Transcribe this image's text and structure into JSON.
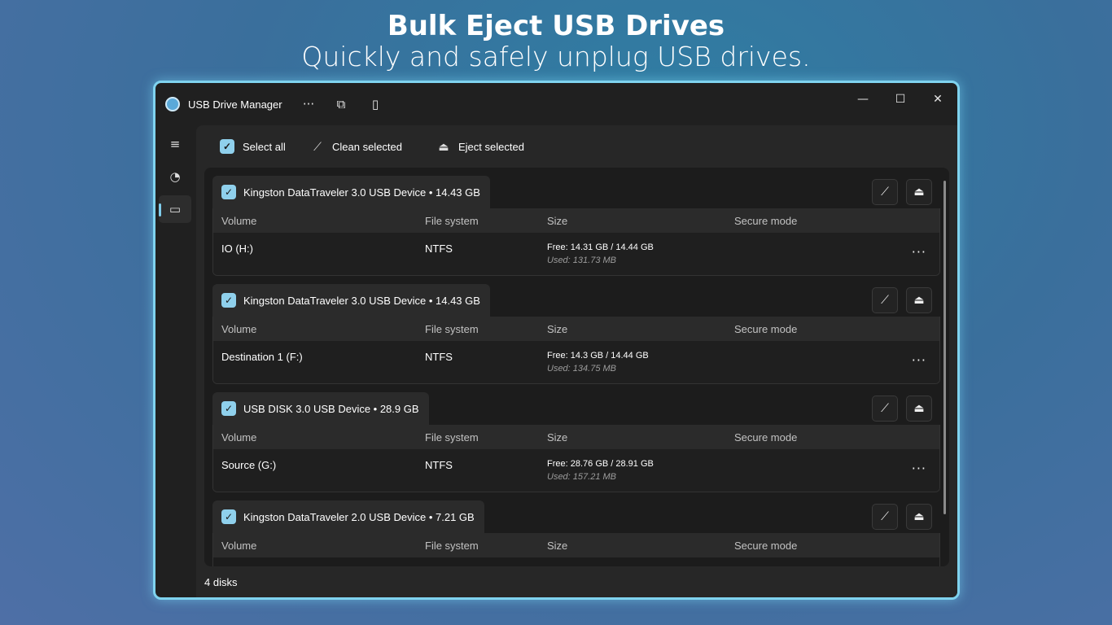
{
  "hero": {
    "title": "Bulk Eject USB Drives",
    "subtitle": "Quickly and safely unplug USB drives."
  },
  "app": {
    "title": "USB Drive Manager",
    "icon": "usb-drive-icon",
    "titlebar_buttons": [
      "more-icon",
      "connect-icon",
      "usb-plug-icon"
    ],
    "window_controls": {
      "minimize": "—",
      "maximize": "☐",
      "close": "✕"
    }
  },
  "sidebar": {
    "items": [
      {
        "name": "hamburger-icon",
        "glyph": "≡"
      },
      {
        "name": "pie-chart-icon",
        "glyph": "◔"
      },
      {
        "name": "drive-icon",
        "glyph": "▭",
        "active": true
      }
    ]
  },
  "toolbar": {
    "select_all": "Select all",
    "clean_selected": "Clean selected",
    "eject_selected": "Eject selected"
  },
  "columns": [
    "Volume",
    "File system",
    "Size",
    "Secure mode"
  ],
  "disks": [
    {
      "name": "Kingston DataTraveler 3.0 USB Device • 14.43 GB",
      "checked": true,
      "volume": "IO (H:)",
      "file_system": "NTFS",
      "free": "Free: 14.31 GB / 14.44 GB",
      "used": "Used: 131.73 MB"
    },
    {
      "name": "Kingston DataTraveler 3.0 USB Device • 14.43 GB",
      "checked": true,
      "volume": "Destination 1 (F:)",
      "file_system": "NTFS",
      "free": "Free: 14.3 GB / 14.44 GB",
      "used": "Used: 134.75 MB"
    },
    {
      "name": "USB DISK 3.0 USB Device • 28.9 GB",
      "checked": true,
      "volume": "Source (G:)",
      "file_system": "NTFS",
      "free": "Free: 28.76 GB / 28.91 GB",
      "used": "Used: 157.21 MB"
    },
    {
      "name": "Kingston DataTraveler 2.0 USB Device • 7.21 GB",
      "checked": true
    }
  ],
  "status": "4 disks",
  "colors": {
    "accent": "#8fd0ec",
    "frame_glow": "#7fd3ef",
    "window_bg": "#202020"
  }
}
